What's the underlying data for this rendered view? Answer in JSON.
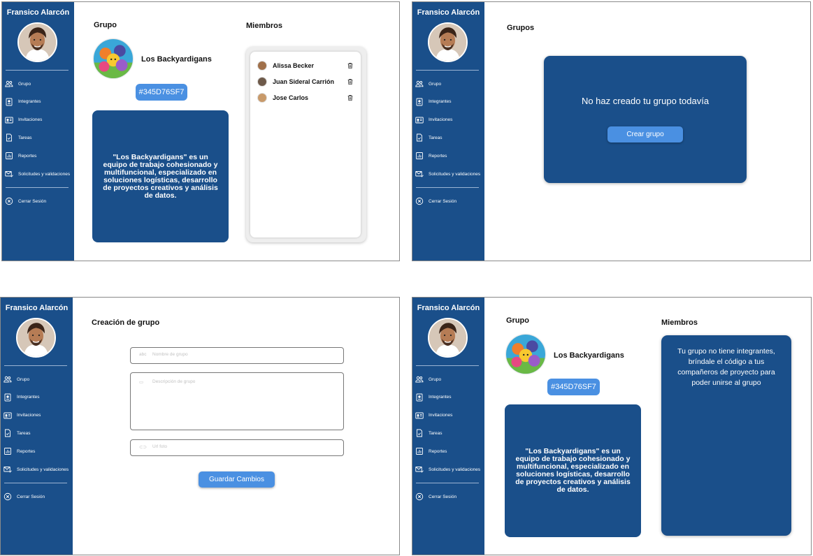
{
  "user": {
    "name": "Fransico Alarcón"
  },
  "sidebar": {
    "items": [
      {
        "label": "Grupo",
        "icon": "users-icon"
      },
      {
        "label": "Integrantes",
        "icon": "id-badge-icon"
      },
      {
        "label": "Invitaciones",
        "icon": "id-card-icon"
      },
      {
        "label": "Tareas",
        "icon": "task-check-icon"
      },
      {
        "label": "Reportes",
        "icon": "chart-icon"
      },
      {
        "label": "Solicitudes y validaciones",
        "icon": "mail-check-icon"
      }
    ],
    "logout": {
      "label": "Cerrar Sesión",
      "icon": "close-circle-icon"
    }
  },
  "group_view": {
    "grupo_title": "Grupo",
    "members_title": "Miembros",
    "group_name": "Los Backyardigans",
    "group_code": "#345D76SF7",
    "description": "\"Los Backyardigans\" es un equipo de trabajo cohesionado y multifuncional, especializado en soluciones logísticas, desarrollo de proyectos creativos y análisis de datos.",
    "members": [
      {
        "name": "Alissa Becker"
      },
      {
        "name": "Juan Sideral Carrión"
      },
      {
        "name": "Jose Carlos"
      }
    ]
  },
  "no_group_view": {
    "title": "Grupos",
    "message": "No haz creado tu grupo todavía",
    "create_button": "Crear grupo"
  },
  "create_view": {
    "title": "Creación de grupo",
    "name_placeholder": "Nombre de grupo",
    "description_placeholder": "Descripción de grupo",
    "url_placeholder": "Url foto",
    "save_button": "Guardar Cambios"
  },
  "empty_members_view": {
    "grupo_title": "Grupo",
    "members_title": "Miembros",
    "empty_message": "Tu grupo no tiene integrantes, bríndale el código a tus compañeros de proyecto para poder unirse al grupo"
  },
  "colors": {
    "sidebar": "#1a4f8a",
    "card": "#1a4f8a",
    "accent": "#4a90e2"
  }
}
